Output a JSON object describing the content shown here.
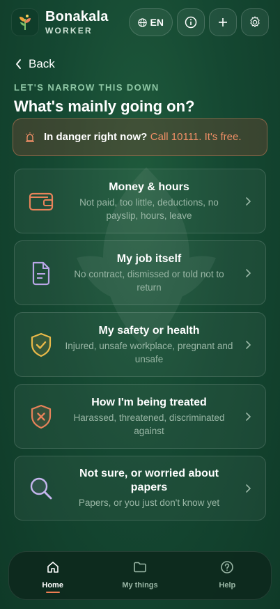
{
  "header": {
    "brand_name": "Bonakala",
    "brand_sub": "WORKER",
    "lang_label": "EN",
    "icons": [
      "globe-icon",
      "info-icon",
      "plus-icon",
      "gear-icon"
    ]
  },
  "nav": {
    "back_label": "Back"
  },
  "page": {
    "eyebrow": "LET'S NARROW THIS DOWN",
    "title": "What's mainly going on?"
  },
  "danger": {
    "text": "In danger right now?",
    "call": "Call 10111. It's free.",
    "icon": "alarm-icon",
    "color": "#f08f66"
  },
  "options": [
    {
      "title": "Money & hours",
      "subtitle": "Not paid, too little, deductions, no payslip, hours, leave",
      "icon": "wallet-icon",
      "color": "#e8835a"
    },
    {
      "title": "My job itself",
      "subtitle": "No contract, dismissed or told not to return",
      "icon": "document-icon",
      "color": "#b9a6e6"
    },
    {
      "title": "My safety or health",
      "subtitle": "Injured, unsafe workplace, pregnant and unsafe",
      "icon": "shield-check-icon",
      "color": "#e9b949"
    },
    {
      "title": "How I'm being treated",
      "subtitle": "Harassed, threatened, discriminated against",
      "icon": "shield-x-icon",
      "color": "#e8835a"
    },
    {
      "title": "Not sure, or worried about papers",
      "subtitle": "Papers, or you just don't know yet",
      "icon": "search-icon",
      "color": "#c5b6ee"
    }
  ],
  "bottom_nav": {
    "items": [
      {
        "label": "Home",
        "icon": "home-icon",
        "active": true
      },
      {
        "label": "My things",
        "icon": "folder-icon",
        "active": false
      },
      {
        "label": "Help",
        "icon": "help-icon",
        "active": false
      }
    ],
    "accent": "#ef7d52"
  }
}
